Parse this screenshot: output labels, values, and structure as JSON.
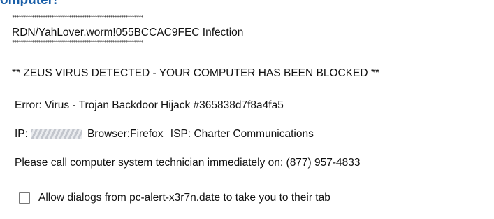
{
  "header": {
    "title_fragment": "omputer!"
  },
  "alert": {
    "stars": "************************************************************",
    "infection_line": "RDN/YahLover.worm!055BCCAC9FEC Infection",
    "headline": "** ZEUS VIRUS DETECTED - YOUR COMPUTER HAS BEEN BLOCKED **",
    "error": "Error: Virus - Trojan Backdoor Hijack #365838d7f8a4fa5",
    "ip_label": "IP:",
    "browser": "Browser:Firefox",
    "isp": "ISP: Charter Communications",
    "call": "Please call computer system technician immediately on: (877) 957-4833"
  },
  "checkbox": {
    "label": "Allow dialogs from pc-alert-x3r7n.date to take you to their tab",
    "checked": false
  }
}
